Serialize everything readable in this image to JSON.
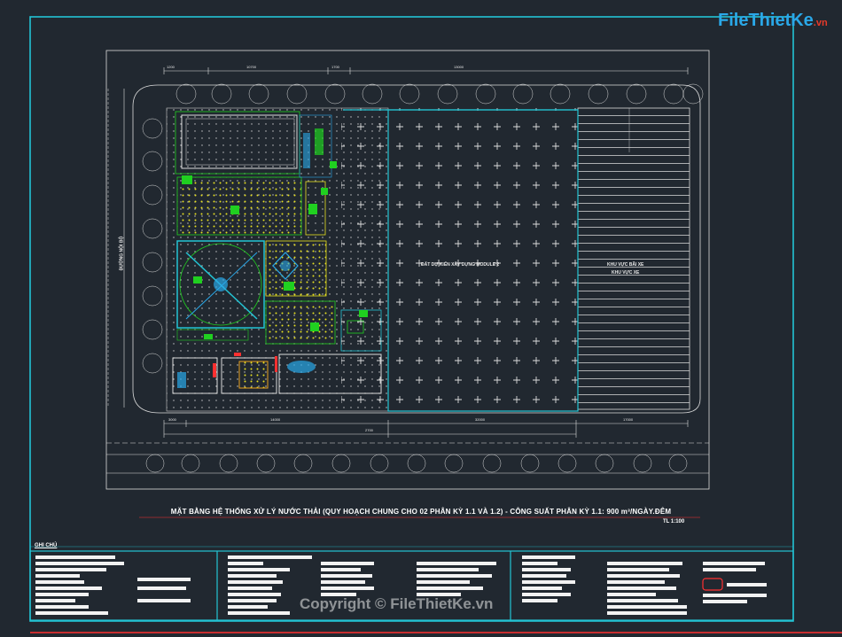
{
  "logo": {
    "brand_file": "File",
    "brand_thietke": "ThietKe",
    "brand_vn": ".vn"
  },
  "drawing": {
    "title": "MẶT BẰNG HỆ THỐNG XỬ LÝ NƯỚC THẢI (QUY HOẠCH CHUNG CHO 02 PHÂN KỲ 1.1 VÀ 1.2) - CÔNG SUẤT PHÂN KỲ 1.1: 900 m³/NGÀY.ĐÊM",
    "scale": "TL 1:100",
    "notes_title": "GHI CHÚ",
    "watermark": "Copyright © FileThietKe.vn",
    "area_label": "ĐẤT DỰ KIẾN XÂY DỰNG MODULE 2",
    "right_label_1": "KHU VỰC BÃI XE",
    "right_label_2": "KHU VỰC XE",
    "road_label": "ĐƯỜNG NỘI BỘ",
    "dims_top": [
      "1200",
      "10700",
      "1700",
      "13000"
    ],
    "dims_bottom": [
      "3000",
      "14000",
      "2700",
      "32000",
      "17000"
    ]
  },
  "colors": {
    "background": "#212830",
    "frame": "#23c4d4",
    "lines": "#dcdcdc",
    "green": "#20d020",
    "yellow": "#e8e020",
    "cyan": "#23c4d4",
    "red": "#ff3030",
    "blue": "#2aa8e8"
  }
}
